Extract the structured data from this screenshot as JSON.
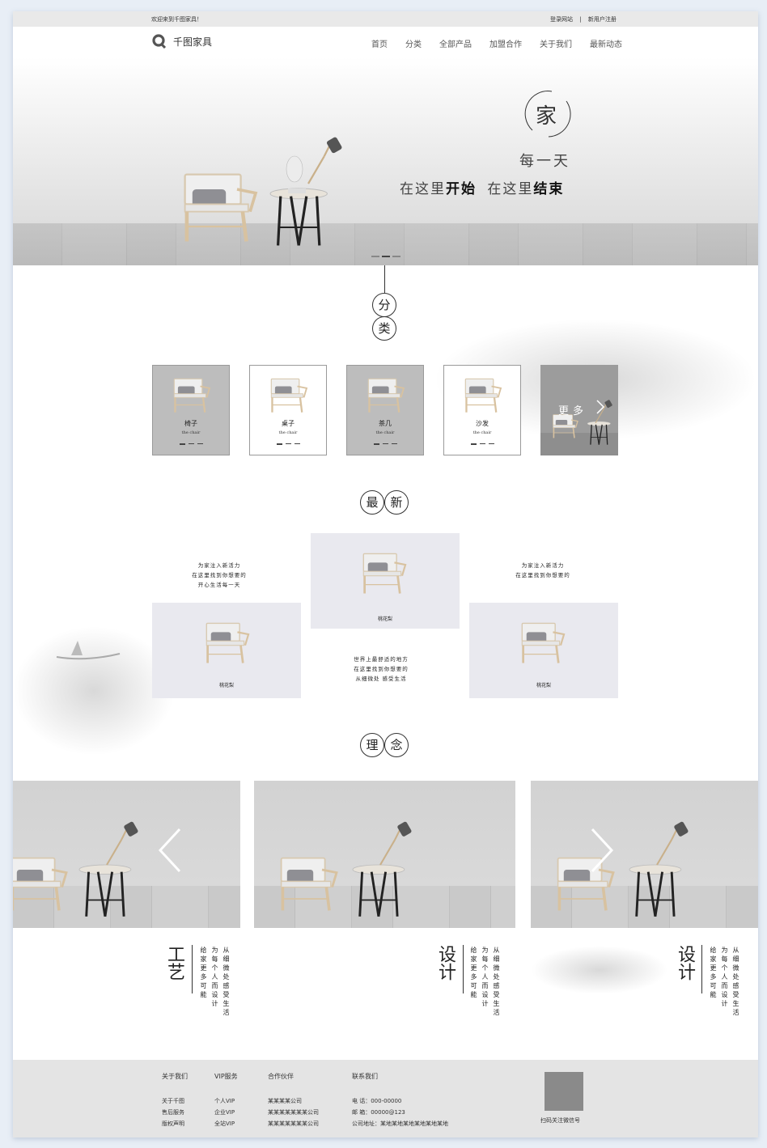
{
  "topbar": {
    "welcome": "欢迎来到千图家具！",
    "login": "登录网站",
    "separator": "|",
    "register": "新用户注册"
  },
  "header": {
    "logo_text": "千图家具",
    "nav": [
      "首页",
      "分类",
      "全部产品",
      "加盟合作",
      "关于我们",
      "最新动态"
    ]
  },
  "hero": {
    "jia": "家",
    "every_day": "每一天",
    "line_a": "在这里",
    "line_b": "开始",
    "line_c": "在这里",
    "line_d": "结束"
  },
  "sections": {
    "category": [
      "分",
      "类"
    ],
    "newest": [
      "最",
      "新"
    ],
    "concept": [
      "理",
      "念"
    ]
  },
  "categories": [
    {
      "name": "椅子",
      "sub": "the chair"
    },
    {
      "name": "桌子",
      "sub": "the chair"
    },
    {
      "name": "茶几",
      "sub": "the chair"
    },
    {
      "name": "沙发",
      "sub": "the chair"
    }
  ],
  "more_label": "更多",
  "newest": {
    "text_left": [
      "为家注入新活力",
      "在这里找到你想要的",
      "开心生活每一天"
    ],
    "text_right": [
      "为家注入新活力",
      "在这里找到你想要的"
    ],
    "text_middle": [
      "世界上最舒适的地方",
      "在这里找到你想要的",
      "从细微处 感受生活"
    ],
    "caption_center": "桃花梨",
    "caption_left": "桃花梨",
    "caption_right": "桃花梨"
  },
  "concept": [
    {
      "title": "工艺",
      "col1": "给家更多可能",
      "col2": "为每个人而设计",
      "col3": "从细微处感受生活"
    },
    {
      "title": "设计",
      "col1": "给家更多可能",
      "col2": "为每个人而设计",
      "col3": "从细微处感受生活"
    },
    {
      "title": "设计",
      "col1": "给家更多可能",
      "col2": "为每个人而设计",
      "col3": "从细微处感受生活"
    }
  ],
  "footer": {
    "about": {
      "head": "关于我们",
      "rows": [
        "关于千图",
        "售后服务",
        "版权声明"
      ]
    },
    "vip": {
      "head": "VIP服务",
      "rows": [
        "个人VIP",
        "企业VIP",
        "全站VIP"
      ]
    },
    "partners": {
      "head": "合作伙伴",
      "rows": [
        "某某某某公司",
        "某某某某某某某公司",
        "某某某某某某某公司"
      ]
    },
    "contact": {
      "head": "联系我们",
      "rows": [
        "电  话：000-00000",
        "邮  箱：00000@123",
        "公司地址：某地某地某地某地某地某地"
      ]
    },
    "qr_caption": "扫码关注微信号"
  },
  "colors": {
    "page_bg": "#e8eef6",
    "gray_card": "#bdbdbd",
    "footer_bg": "#e4e4e4",
    "text_dark": "#222222"
  }
}
